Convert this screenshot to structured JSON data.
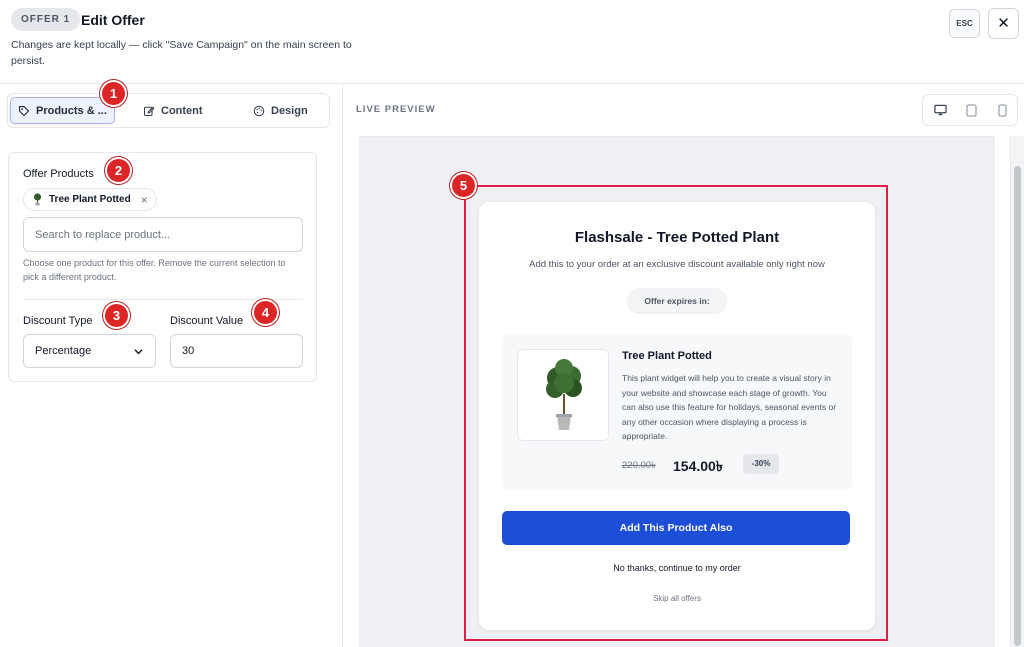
{
  "header": {
    "badge": "OFFER 1",
    "title": "Edit Offer",
    "subtitle": "Changes are kept locally — click \"Save Campaign\" on the main screen to persist.",
    "esc_label": "ESC",
    "close_symbol": "✕"
  },
  "tabs": [
    {
      "label": "Products & ...",
      "icon": "tag-icon",
      "active": true
    },
    {
      "label": "Content",
      "icon": "edit-icon",
      "active": false
    },
    {
      "label": "Design",
      "icon": "palette-icon",
      "active": false
    }
  ],
  "offer_form": {
    "products_label": "Offer Products",
    "selected_product": "Tree Plant Potted",
    "remove_symbol": "×",
    "search_placeholder": "Search to replace product...",
    "help_text": "Choose one product for this offer. Remove the current selection to pick a different product.",
    "discount_type_label": "Discount Type",
    "discount_type_value": "Percentage",
    "discount_value_label": "Discount Value",
    "discount_value": "30"
  },
  "markers": [
    "1",
    "2",
    "3",
    "4",
    "5"
  ],
  "preview": {
    "label": "LIVE PREVIEW",
    "devices": [
      "desktop-icon",
      "tablet-icon",
      "mobile-icon"
    ],
    "offer_title": "Flashsale - Tree Potted Plant",
    "offer_subtitle": "Add this to your order at an exclusive discount available only right now",
    "expires_label": "Offer expires in:",
    "product_name": "Tree Plant Potted",
    "product_description": "This plant widget will help you to create a visual story in your website and showcase each stage of growth. You can also use this feature for holidays, seasonal events or any other occasion where displaying a process is appropriate.",
    "old_price": "220.00৳",
    "new_price": "154.00৳",
    "discount_badge": "-30%",
    "add_button": "Add This Product Also",
    "decline_link": "No thanks, continue to my order",
    "skip_link": "Skip all offers"
  },
  "colors": {
    "primary_button": "#1d4ed8",
    "marker": "#dc2626",
    "highlight_border": "#e11d48"
  }
}
